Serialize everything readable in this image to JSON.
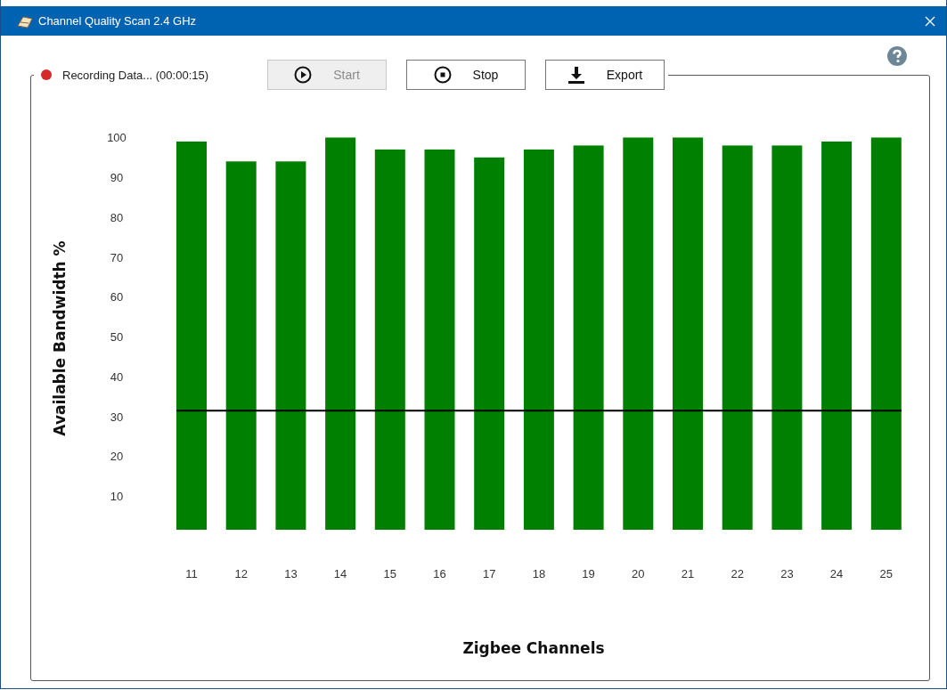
{
  "window": {
    "title": "Channel Quality Scan 2.4 GHz"
  },
  "status": {
    "recording": true,
    "text": "Recording Data... (00:00:15)"
  },
  "buttons": [
    {
      "kind": "play",
      "label": "Start",
      "disabled": true
    },
    {
      "kind": "stop",
      "label": "Stop",
      "disabled": false
    },
    {
      "kind": "export",
      "label": "Export",
      "disabled": false
    }
  ],
  "chart_data": {
    "type": "bar",
    "xlabel": "Zigbee Channels",
    "ylabel": "Available Bandwidth %",
    "categories": [
      "11",
      "12",
      "13",
      "14",
      "15",
      "16",
      "17",
      "18",
      "19",
      "20",
      "21",
      "22",
      "23",
      "24",
      "25"
    ],
    "series": [
      {
        "color": "#008000",
        "values": [
          99,
          94,
          94,
          100,
          97,
          97,
          95,
          97,
          98,
          100,
          100,
          98,
          98,
          99,
          100
        ]
      }
    ],
    "ylim": [
      1.5,
      101
    ],
    "yticks": [
      10,
      20,
      30,
      40,
      50,
      60,
      70,
      80,
      90,
      100
    ],
    "ref_lines": [
      {
        "axis": "y",
        "value": 31.4,
        "color": "#000000"
      }
    ]
  }
}
